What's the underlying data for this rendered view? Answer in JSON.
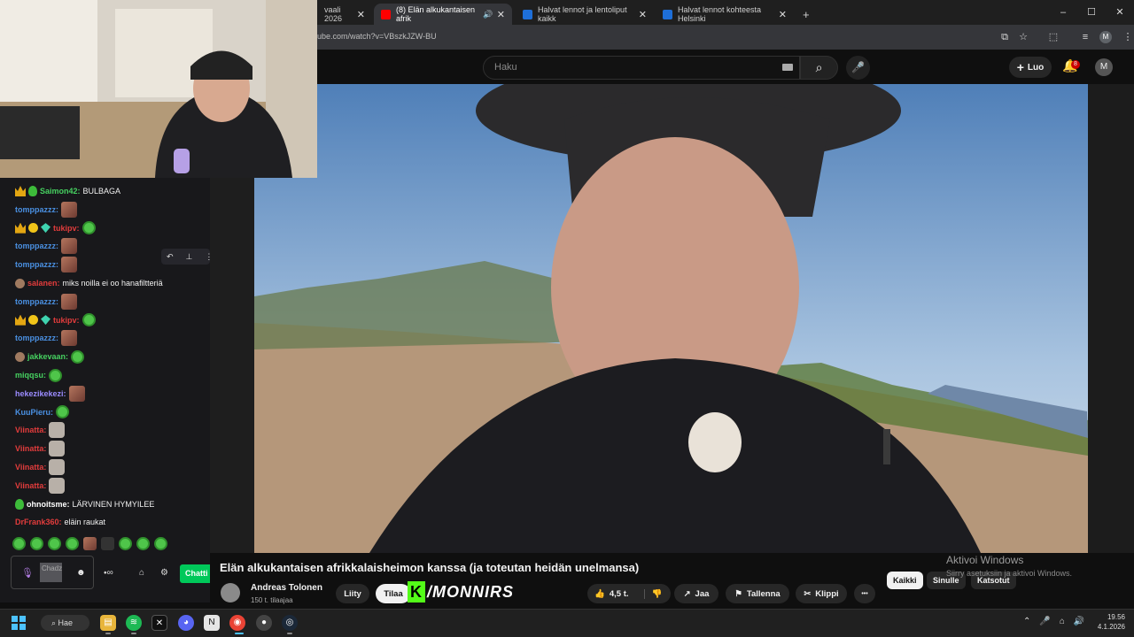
{
  "browser": {
    "tabs": [
      {
        "label": "vaali 2026",
        "active": false
      },
      {
        "label": "(8) Elän alkukantaisen afrik",
        "active": true
      },
      {
        "label": "Halvat lennot ja lentoliput kaikk",
        "active": false
      },
      {
        "label": "Halvat lennot kohteesta Helsinki",
        "active": false
      }
    ],
    "new_tab": "+",
    "url": "ube.com/watch?v=VBszkJZW-BU",
    "profile_initial": "M",
    "window_controls": [
      "–",
      "☐",
      "✕"
    ]
  },
  "youtube": {
    "search_placeholder": "Haku",
    "create_label": "Luo",
    "notification_count": "8",
    "avatar_initial": "M",
    "video_title": "Elän alkukantaisen afrikkalaisheimon kanssa (ja toteutan heidän unelmansa)",
    "channel_name": "Andreas Tolonen",
    "channel_subs": "150 t. tilaajaa",
    "join_label": "Liity",
    "subscribe_label": "Tilaa",
    "like_count": "4,5 t.",
    "share_label": "Jaa",
    "save_label": "Tallenna",
    "clip_label": "Klippi",
    "more_label": "•••",
    "chips": [
      "Kaikki",
      "Sinulle",
      "Katsotut"
    ]
  },
  "overlay": {
    "brand_letter": "K",
    "brand_text": "/MONNIRS"
  },
  "windows_activation": {
    "title": "Aktivoi Windows",
    "subtitle": "Siirry asetuksiin ja aktivoi Windows."
  },
  "chat": {
    "messages": [
      {
        "user": "Saimon42:",
        "color": "#46d160",
        "text": "BULBAGA",
        "badges": [
          "crown",
          "sub"
        ],
        "emote": ""
      },
      {
        "user": "tomppazzz:",
        "color": "#4a90e2",
        "text": "",
        "badges": [],
        "emote": "bad"
      },
      {
        "user": "tukipv:",
        "color": "#e23c3c",
        "text": "",
        "badges": [
          "crown",
          "coin",
          "gem"
        ],
        "emote": "green"
      },
      {
        "user": "tomppazzz:",
        "color": "#4a90e2",
        "text": "",
        "badges": [],
        "emote": "bad"
      },
      {
        "user": "tomppazzz:",
        "color": "#4a90e2",
        "text": "",
        "badges": [],
        "emote": "bad"
      },
      {
        "user": "salanen:",
        "color": "#e23c3c",
        "text": "miks noilla ei oo hanafiltteriä",
        "badges": [
          "face"
        ],
        "emote": ""
      },
      {
        "user": "tomppazzz:",
        "color": "#4a90e2",
        "text": "",
        "badges": [],
        "emote": "bad"
      },
      {
        "user": "tukipv:",
        "color": "#e23c3c",
        "text": "",
        "badges": [
          "crown",
          "coin",
          "gem"
        ],
        "emote": "green"
      },
      {
        "user": "tomppazzz:",
        "color": "#4a90e2",
        "text": "",
        "badges": [],
        "emote": "bad"
      },
      {
        "user": "jakkevaan:",
        "color": "#46d160",
        "text": "",
        "badges": [
          "face"
        ],
        "emote": "green"
      },
      {
        "user": "miqqsu:",
        "color": "#46d160",
        "text": "",
        "badges": [],
        "emote": "green"
      },
      {
        "user": "hekezikekezi:",
        "color": "#9b8cff",
        "text": "",
        "badges": [],
        "emote": "bad"
      },
      {
        "user": "KuuPieru:",
        "color": "#4a90e2",
        "text": "",
        "badges": [],
        "emote": "green"
      },
      {
        "user": "Viinatta:",
        "color": "#e23c3c",
        "text": "",
        "badges": [],
        "emote": "cat"
      },
      {
        "user": "Viinatta:",
        "color": "#e23c3c",
        "text": "",
        "badges": [],
        "emote": "cat"
      },
      {
        "user": "Viinatta:",
        "color": "#e23c3c",
        "text": "",
        "badges": [],
        "emote": "cat"
      },
      {
        "user": "Viinatta:",
        "color": "#e23c3c",
        "text": "",
        "badges": [],
        "emote": "cat"
      },
      {
        "user": "ohnoitsme:",
        "color": "#ffffff",
        "text": "LÄRVINEN HYMYILEE",
        "badges": [
          "sub"
        ],
        "emote": ""
      },
      {
        "user": "DrFrank360:",
        "color": "#e23c3c",
        "text": "eläin raukat",
        "badges": [],
        "emote": ""
      }
    ],
    "input_placeholder": "Chadz",
    "chat_button": "Chatti"
  },
  "taskbar": {
    "search_label": "Hae",
    "time": "19.56",
    "date": "4.1.2026"
  }
}
